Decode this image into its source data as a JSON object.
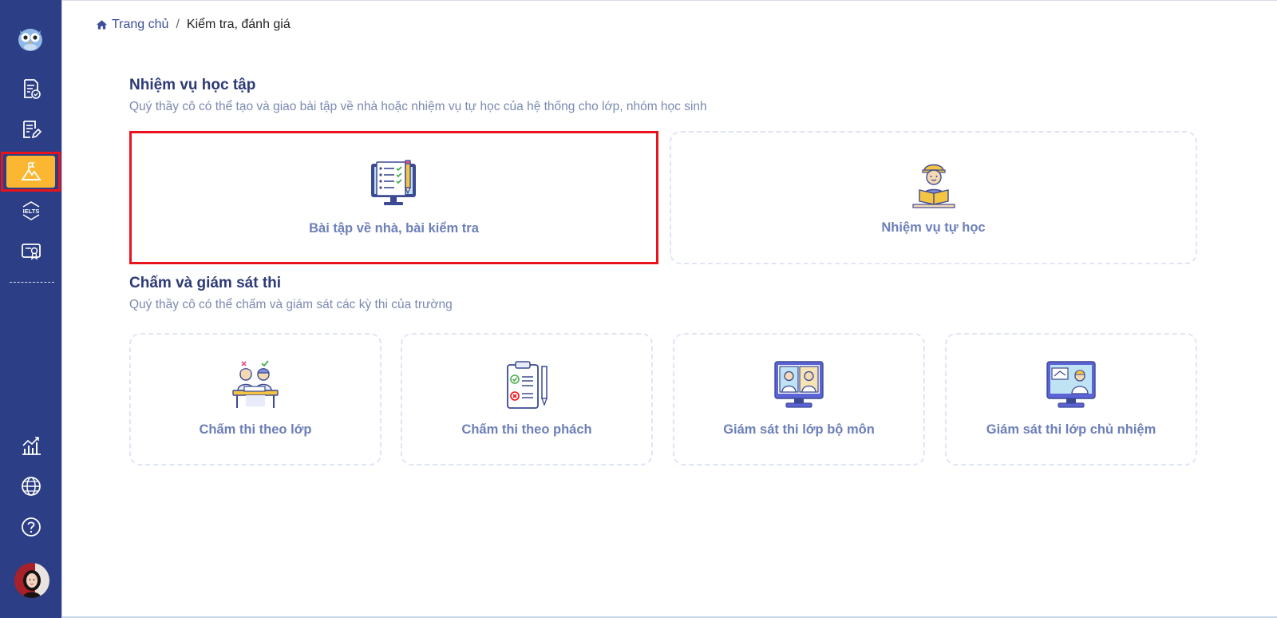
{
  "breadcrumb": {
    "home": "Trang chủ",
    "separator": "/",
    "current": "Kiểm tra, đánh giá"
  },
  "sections": {
    "tasks": {
      "title": "Nhiệm vụ học tập",
      "description": "Quý thầy cô có thể tạo và giao bài tập về nhà hoặc nhiệm vụ tự học của hệ thống cho lớp, nhóm học sinh",
      "cards": [
        {
          "label": "Bài tập về nhà, bài kiểm tra",
          "icon": "checklist-monitor-icon"
        },
        {
          "label": "Nhiệm vụ tự học",
          "icon": "student-reading-icon"
        }
      ]
    },
    "grading": {
      "title": "Chấm và giám sát thi",
      "description": "Quý thầy cô có thể chấm và giám sát các kỳ thi của trường",
      "cards": [
        {
          "label": "Chấm thi theo lớp",
          "icon": "students-desk-icon"
        },
        {
          "label": "Chấm thi theo phách",
          "icon": "clipboard-checklist-icon"
        },
        {
          "label": "Giám sát thi lớp bộ môn",
          "icon": "monitor-proctor-icon"
        },
        {
          "label": "Giám sát thi lớp chủ nhiệm",
          "icon": "monitor-homeroom-icon"
        }
      ]
    }
  },
  "sidebar": {
    "items": [
      {
        "name": "owl-logo",
        "icon": "owl-icon"
      },
      {
        "name": "exam-list",
        "icon": "document-check-icon"
      },
      {
        "name": "assignments",
        "icon": "document-edit-icon"
      },
      {
        "name": "assessment",
        "icon": "mountain-flag-icon",
        "active": true
      },
      {
        "name": "ielts",
        "icon": "ielts-icon",
        "text": "IELTS"
      },
      {
        "name": "certificates",
        "icon": "certificate-icon"
      },
      {
        "name": "statistics",
        "icon": "chart-icon"
      },
      {
        "name": "language",
        "icon": "globe-icon"
      },
      {
        "name": "help",
        "icon": "help-icon"
      },
      {
        "name": "user",
        "icon": "avatar"
      }
    ]
  },
  "colors": {
    "sidebar": "#2c3e86",
    "active": "#fbb731",
    "highlight": "#e8131b",
    "title": "#2c3a75",
    "muted": "#7a89b0",
    "cardLabel": "#6c7fb8"
  }
}
